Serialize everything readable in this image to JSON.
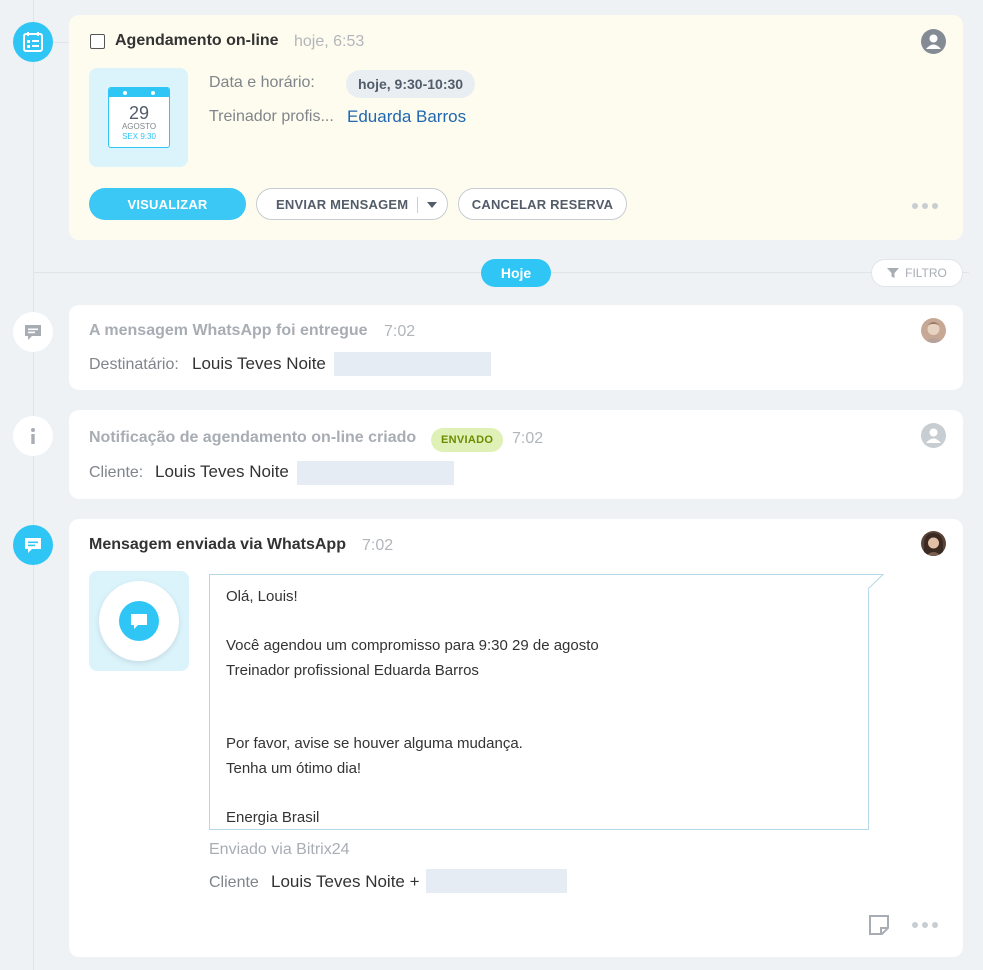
{
  "booking": {
    "title": "Agendamento on-line",
    "time": "hoje, 6:53",
    "calendar": {
      "day": "29",
      "month": "AGOSTO",
      "weekday_time": "SEX 9:30"
    },
    "date_label": "Data e horário:",
    "date_value": "hoje, 9:30-10:30",
    "trainer_label": "Treinador profis...",
    "trainer_value": "Eduarda Barros",
    "buttons": {
      "view": "VISUALIZAR",
      "send_message": "ENVIAR MENSAGEM",
      "cancel": "CANCELAR RESERVA"
    }
  },
  "divider": {
    "today": "Hoje",
    "filter": "FILTRO"
  },
  "whatsapp_delivered": {
    "title": "A mensagem WhatsApp foi entregue",
    "time": "7:02",
    "recipient_label": "Destinatário:",
    "recipient_value": "Louis Teves Noite"
  },
  "notification": {
    "title": "Notificação de agendamento on-line criado",
    "badge": "ENVIADO",
    "time": "7:02",
    "client_label": "Cliente:",
    "client_value": "Louis Teves Noite"
  },
  "whatsapp_sent": {
    "title": "Mensagem enviada via WhatsApp",
    "time": "7:02",
    "message_lines": [
      "Olá, Louis!",
      "",
      "Você agendou um compromisso para 9:30 29 de agosto",
      "Treinador profissional Eduarda Barros",
      "",
      "",
      "Por favor, avise se houver alguma mudança.",
      "Tenha um ótimo dia!",
      "",
      "Energia Brasil"
    ],
    "sent_via": "Enviado via Bitrix24",
    "client_label": "Cliente",
    "client_value": "Louis Teves Noite +"
  },
  "colors": {
    "accent": "#2fc6f6",
    "primary_button": "#3bc8f5",
    "card_highlight": "#fefcee",
    "badge_bg": "#dff1b6",
    "badge_text": "#6d8a00",
    "link": "#2067b0"
  }
}
